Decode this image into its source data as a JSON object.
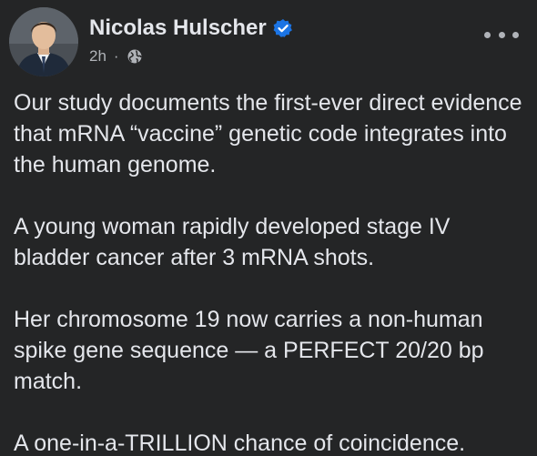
{
  "post": {
    "author": "Nicolas Hulscher",
    "time": "2h",
    "separator": "·",
    "audience_icon": "globe-icon",
    "verified_icon": "verified-badge-icon",
    "more_icon": "more-options-icon",
    "paragraphs": [
      "Our study documents the first-ever direct evidence that mRNA “vaccine” genetic code integrates into the human genome.",
      "A young woman rapidly developed stage IV bladder cancer after 3 mRNA shots.",
      "Her chromosome 19 now carries a non-human spike gene sequence — a PERFECT 20/20 bp match.",
      "A one-in-a-TRILLION chance of coincidence."
    ]
  },
  "colors": {
    "background": "#242526",
    "text_primary": "#e4e6eb",
    "text_secondary": "#b0b3b8",
    "verified_blue": "#1b74e4"
  }
}
